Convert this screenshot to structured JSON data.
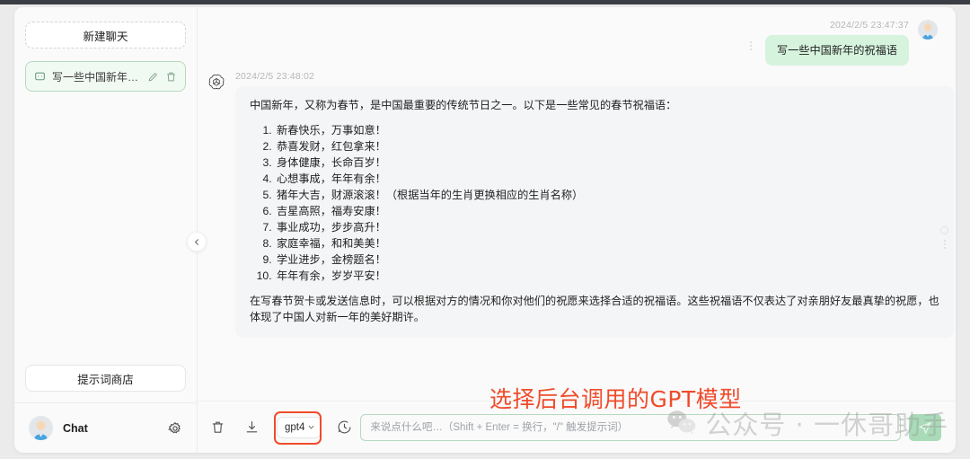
{
  "sidebar": {
    "new_chat_label": "新建聊天",
    "chat_items": [
      {
        "title": "写一些中国新年的…",
        "message_icon": "message-square-icon",
        "edit_icon": "pencil-icon",
        "delete_icon": "trash-icon"
      }
    ],
    "prompt_store_label": "提示词商店",
    "user": {
      "name": "Chat",
      "avatar_icon": "user-avatar",
      "settings_icon": "gear-icon"
    },
    "collapse_icon": "chevron-left-icon"
  },
  "conversation": {
    "messages": [
      {
        "role": "user",
        "timestamp": "2024/2/5 23:47:37",
        "text": "写一些中国新年的祝福语",
        "avatar_icon": "user-avatar"
      },
      {
        "role": "assistant",
        "timestamp": "2024/2/5 23:48:02",
        "avatar_icon": "openai-logo-icon",
        "intro": "中国新年，又称为春节，是中国最重要的传统节日之一。以下是一些常见的春节祝福语：",
        "list": [
          "新春快乐，万事如意！",
          "恭喜发财，红包拿来！",
          "身体健康，长命百岁！",
          "心想事成，年年有余！",
          "猪年大吉，财源滚滚！（根据当年的生肖更换相应的生肖名称）",
          "吉星高照，福寿安康！",
          "事业成功，步步高升！",
          "家庭幸福，和和美美！",
          "学业进步，金榜题名！",
          "年年有余，岁岁平安！"
        ],
        "outro": "在写春节贺卡或发送信息时，可以根据对方的情况和你对他们的祝愿来选择合适的祝福语。这些祝福语不仅表达了对亲朋好友最真挚的祝愿，也体现了中国人对新一年的美好期许。"
      }
    ]
  },
  "composer": {
    "clear_icon": "trash-icon",
    "export_icon": "download-icon",
    "model_value": "gpt4",
    "model_chevron_icon": "chevron-down-icon",
    "history_icon": "clock-icon",
    "input_value": "",
    "input_placeholder": "来说点什么吧…（Shift + Enter = 换行，\"/\" 触发提示词）",
    "send_icon": "send-icon"
  },
  "annotation": {
    "text": "选择后台调用的GPT模型",
    "color": "#f04b2b"
  },
  "watermark": {
    "text": "公众号 · 一休哥助手",
    "logo_icon": "wechat-icon"
  },
  "colors": {
    "accent_green": "#a9dbb8",
    "bubble_user": "#d6f3dd",
    "bubble_bot": "#f4f5f7",
    "annotation_red": "#f04b2b"
  }
}
